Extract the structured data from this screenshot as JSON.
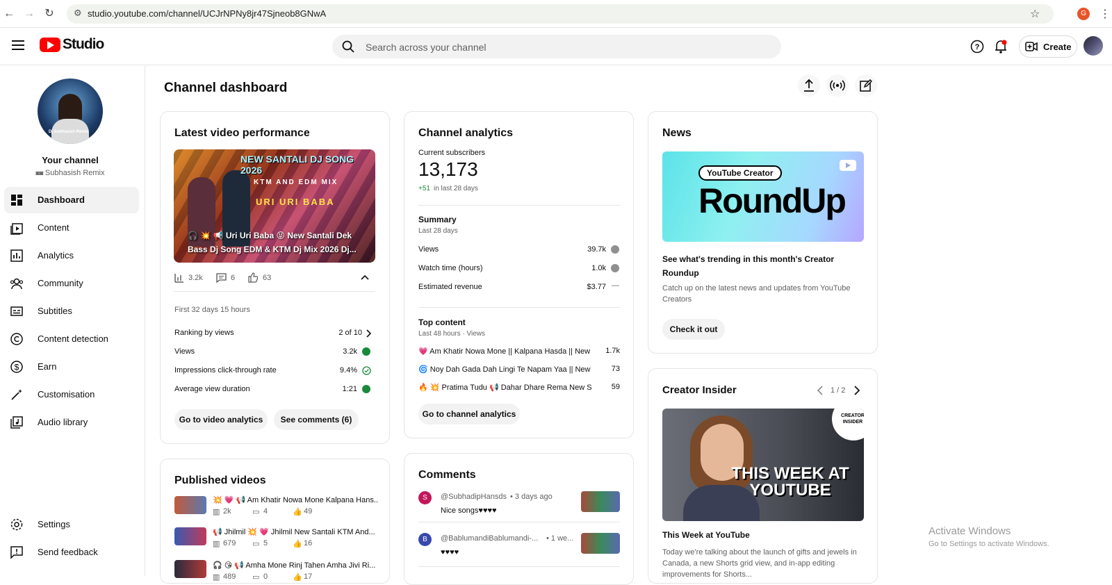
{
  "browser": {
    "url": "studio.youtube.com/channel/UCJrNPNy8jr47Sjneob8GNwA",
    "profile_initial": "G"
  },
  "header": {
    "logo_text": "Studio",
    "search_placeholder": "Search across your channel",
    "create_label": "Create"
  },
  "sidebar": {
    "channel_label": "Your channel",
    "channel_name": "Subhasish Remix",
    "avatar_caption": "Dj Subhasish Remix",
    "items": [
      {
        "label": "Dashboard"
      },
      {
        "label": "Content"
      },
      {
        "label": "Analytics"
      },
      {
        "label": "Community"
      },
      {
        "label": "Subtitles"
      },
      {
        "label": "Content detection"
      },
      {
        "label": "Earn"
      },
      {
        "label": "Customisation"
      },
      {
        "label": "Audio library"
      }
    ],
    "bottom": [
      {
        "label": "Settings"
      },
      {
        "label": "Send feedback"
      }
    ]
  },
  "page": {
    "title": "Channel dashboard"
  },
  "latest": {
    "title": "Latest video performance",
    "thumb_banner": "NEW SANTALI DJ SONG 2026",
    "thumb_sub": "KTM AND EDM MIX",
    "thumb_song": "URI URI BABA",
    "video_title": "🎧 💥 📢 Uri Uri Baba 😝 New Santali Dek Bass Dj Song EDM & KTM Dj Mix 2026 Dj...",
    "views_stat": "3.2k",
    "comments_stat": "6",
    "likes_stat": "63",
    "period": "First 32 days 15 hours",
    "rows": [
      {
        "label": "Ranking by views",
        "value": "2 of 10"
      },
      {
        "label": "Views",
        "value": "3.2k"
      },
      {
        "label": "Impressions click-through rate",
        "value": "9.4%"
      },
      {
        "label": "Average view duration",
        "value": "1:21"
      }
    ],
    "btn_analytics": "Go to video analytics",
    "btn_comments": "See comments (6)"
  },
  "analytics": {
    "title": "Channel analytics",
    "subs_label": "Current subscribers",
    "subs_value": "13,173",
    "subs_change": "+51",
    "subs_change_period": "in last 28 days",
    "summary_title": "Summary",
    "summary_period": "Last 28 days",
    "summary_rows": [
      {
        "label": "Views",
        "value": "39.7k"
      },
      {
        "label": "Watch time (hours)",
        "value": "1.0k"
      },
      {
        "label": "Estimated revenue",
        "value": "$3.77"
      }
    ],
    "top_title": "Top content",
    "top_period": "Last 48 hours · Views",
    "top_rows": [
      {
        "title": "💗 Am Khatir Nowa Mone || Kalpana Hasda || New S...",
        "value": "1.7k"
      },
      {
        "title": "🌀 Noy Dah Gada Dah Lingi Te Napam Yaa || New Sa...",
        "value": "73"
      },
      {
        "title": "🔥 💥 Pratima Tudu 📢 Dahar Dhare Rema New Sa...",
        "value": "59"
      }
    ],
    "btn": "Go to channel analytics"
  },
  "news": {
    "title": "News",
    "banner_small": "YouTube Creator",
    "banner_big": "RoundUp",
    "headline": "See what's trending in this month's Creator Roundup",
    "desc": "Catch up on the latest news and updates from YouTube Creators",
    "btn": "Check it out"
  },
  "insider": {
    "title": "Creator Insider",
    "pager": "1 / 2",
    "badge": "CREATOR INSIDER",
    "overlay": "THIS WEEK AT YOUTUBE",
    "video_title": "This Week at YouTube",
    "desc": "Today we're talking about the launch of gifts and jewels in Canada, a new Shorts grid view, and in-app editing improvements for Shorts..."
  },
  "published": {
    "title": "Published videos",
    "items": [
      {
        "title": "💥 💗 📢 Am Khatir Nowa Mone Kalpana Hans...",
        "views": "2k",
        "comments": "4",
        "likes": "49"
      },
      {
        "title": "📢 Jhilmil 💥 💗 Jhilmil New Santali KTM And...",
        "views": "679",
        "comments": "5",
        "likes": "16"
      },
      {
        "title": "🎧 😘 📢 Amha Mone Rinj Tahen Amha Jivi Ri...",
        "views": "489",
        "comments": "0",
        "likes": "17"
      }
    ]
  },
  "comments": {
    "title": "Comments",
    "items": [
      {
        "initial": "S",
        "author": "@SubhadipHansds",
        "time": "• 3 days ago",
        "text": "Nice songs♥♥♥♥",
        "color": "#c2185b"
      },
      {
        "initial": "B",
        "author": "@BablumandiBablumandi-...",
        "time": "• 1 we...",
        "text": "♥♥♥♥",
        "color": "#3949ab"
      }
    ]
  },
  "watermark": {
    "line1": "Activate Windows",
    "line2": "Go to Settings to activate Windows."
  },
  "colors": {
    "brand_red": "#ff0000",
    "positive_green": "#1a8a3a"
  }
}
